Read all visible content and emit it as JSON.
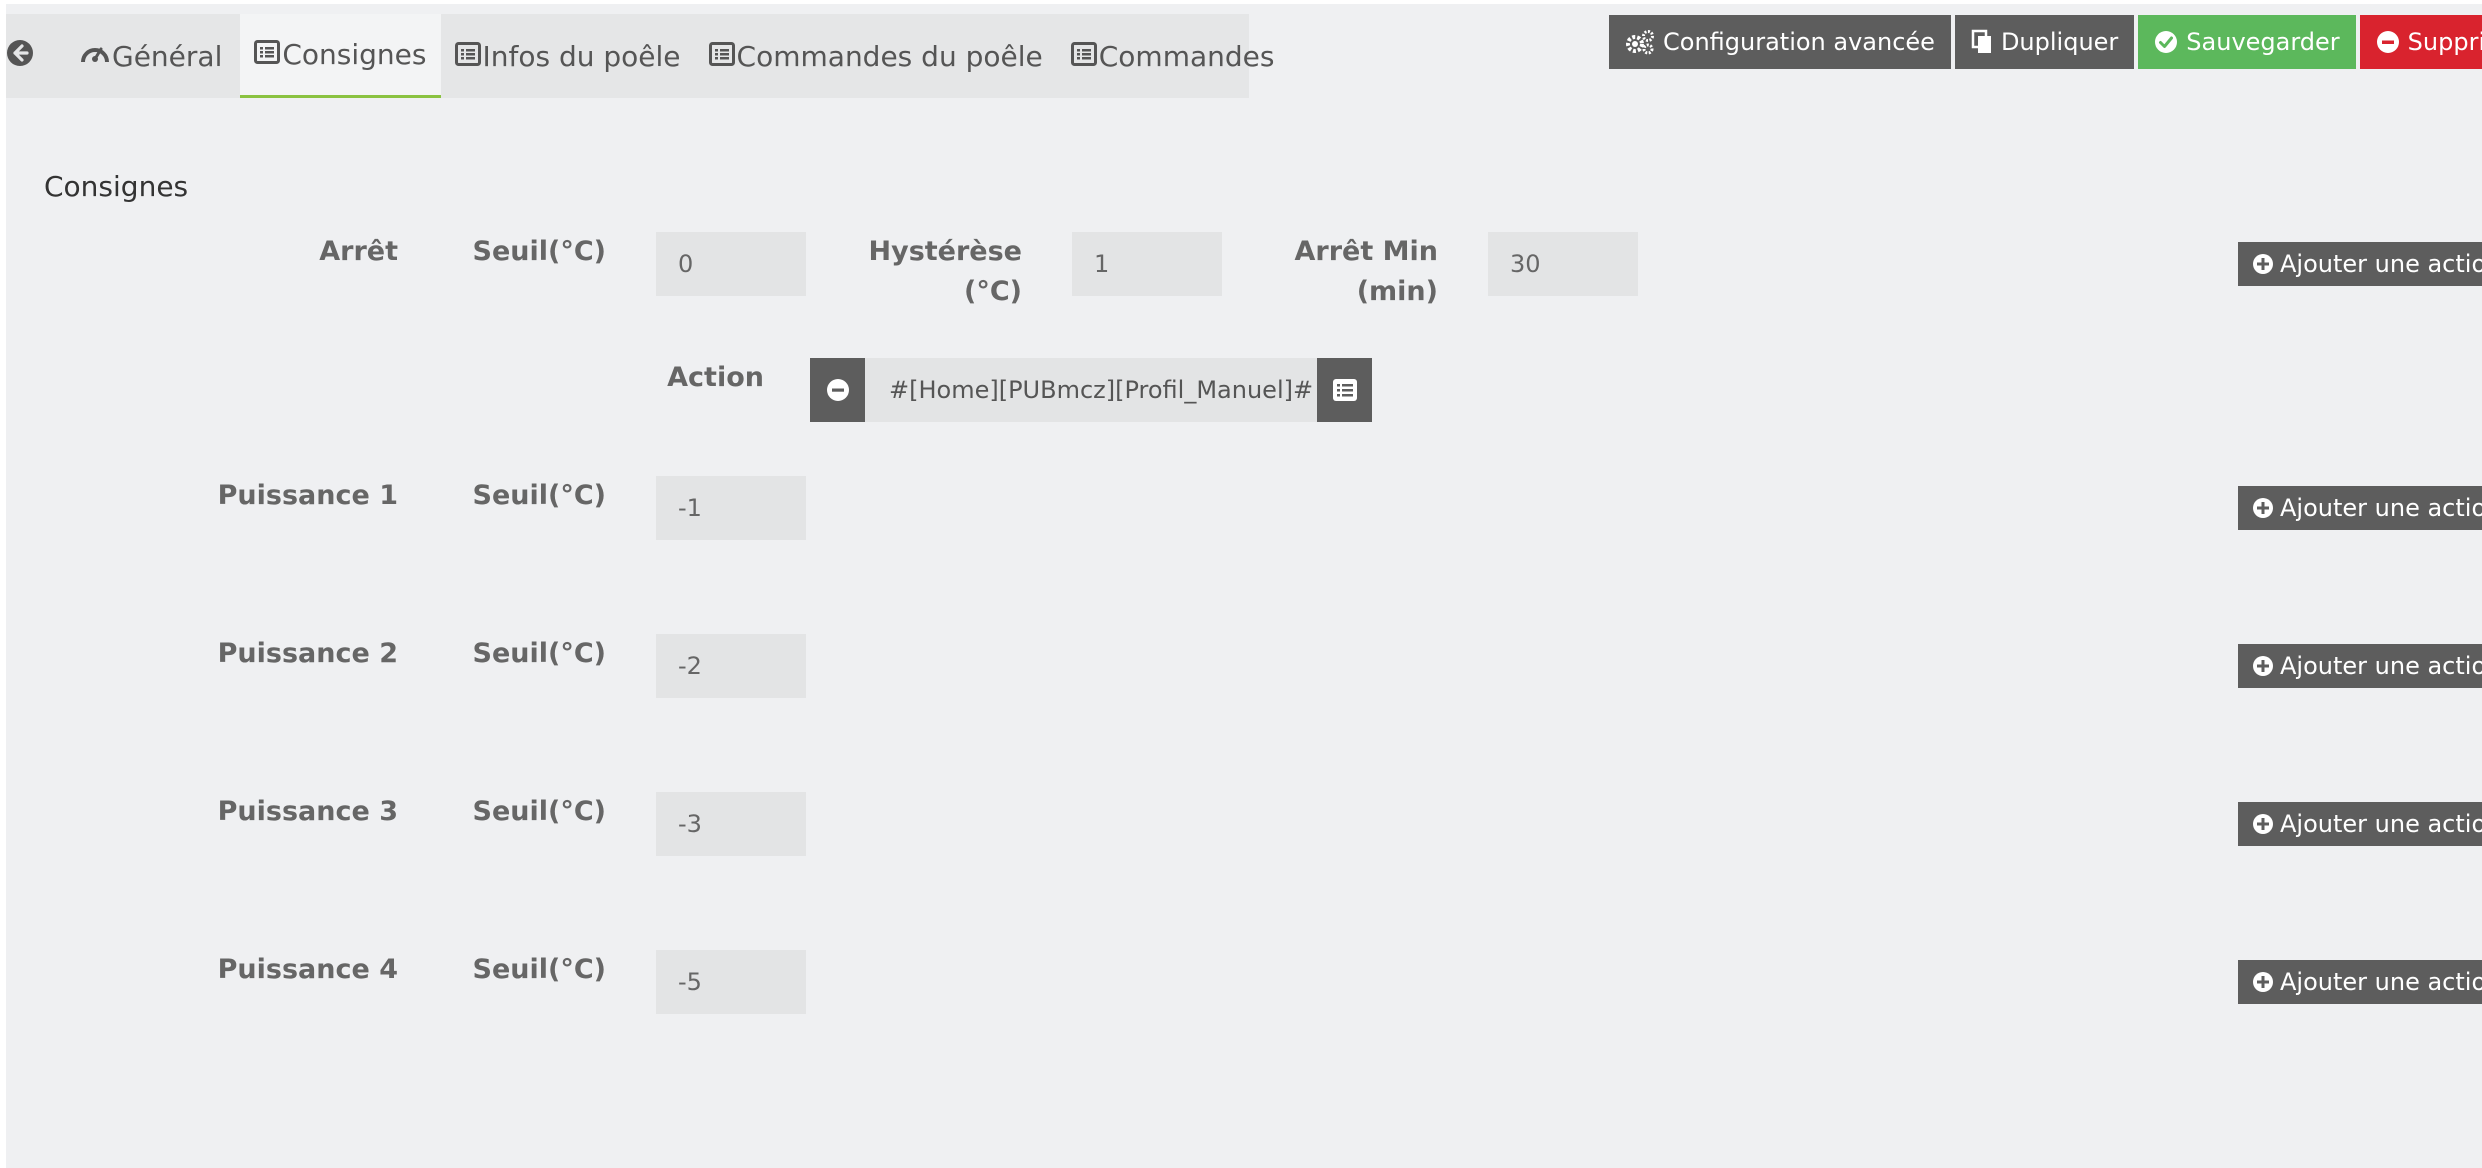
{
  "tabs": {
    "general": "Général",
    "consignes": "Consignes",
    "infos": "Infos du poêle",
    "commandes_poele": "Commandes du poêle",
    "commandes": "Commandes"
  },
  "toolbar": {
    "config": "Configuration avancée",
    "duplicate": "Dupliquer",
    "save": "Sauvegarder",
    "delete": "Supprimer"
  },
  "section": {
    "title": "Consignes"
  },
  "labels": {
    "seuil": "Seuil(°C)",
    "hysteresis_line1": "Hystérèse",
    "hysteresis_line2": "(°C)",
    "arret_min_line1": "Arrêt Min",
    "arret_min_line2": "(min)",
    "action": "Action",
    "add_action": "Ajouter une action"
  },
  "arret": {
    "label": "Arrêt",
    "seuil": "0",
    "hysteresis": "1",
    "arret_min": "30",
    "action_value": "#[Home][PUBmcz][Profil_Manuel]#"
  },
  "puissances": [
    {
      "label": "Puissance 1",
      "seuil": "-1"
    },
    {
      "label": "Puissance 2",
      "seuil": "-2"
    },
    {
      "label": "Puissance 3",
      "seuil": "-3"
    },
    {
      "label": "Puissance 4",
      "seuil": "-5"
    }
  ],
  "colors": {
    "accent_tab": "#8ac240",
    "save": "#5cb85c",
    "delete": "#d9232e",
    "dark_button": "#5d5d5d"
  },
  "icons": {
    "back": "arrow-circle-left-icon",
    "general": "tachometer-icon",
    "tab_list": "list-alt-icon",
    "config": "cogs-icon",
    "duplicate": "copy-icon",
    "save": "check-circle-icon",
    "delete": "minus-circle-icon",
    "add": "plus-circle-icon",
    "remove": "minus-circle-icon",
    "select": "list-alt-icon"
  }
}
